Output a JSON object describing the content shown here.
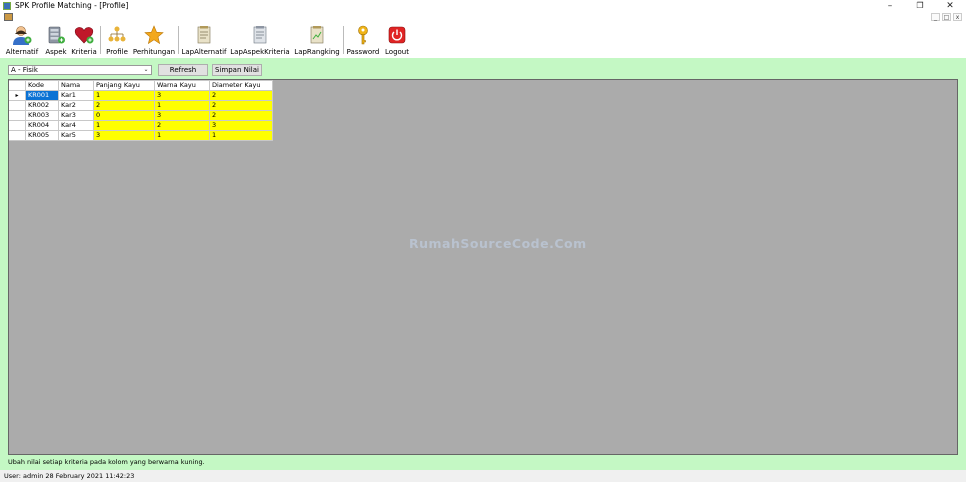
{
  "window": {
    "title": "SPK Profile Matching - [Profile]"
  },
  "toolbar": {
    "items": [
      {
        "label": "Alternatif",
        "icon": "user-icon"
      },
      {
        "label": "Aspek",
        "icon": "database-add-icon"
      },
      {
        "label": "Kriteria",
        "icon": "heart-icon"
      },
      {
        "label": "Profile",
        "icon": "hierarchy-icon"
      },
      {
        "label": "Perhitungan",
        "icon": "star-icon"
      },
      {
        "label": "LapAlternatif",
        "icon": "report-icon"
      },
      {
        "label": "LapAspekKriteria",
        "icon": "report-icon"
      },
      {
        "label": "LapRangking",
        "icon": "report-icon"
      },
      {
        "label": "Password",
        "icon": "key-icon"
      },
      {
        "label": "Logout",
        "icon": "power-icon"
      }
    ]
  },
  "filter": {
    "selected": "A - Fisik",
    "refresh_label": "Refresh",
    "save_label": "Simpan Nilai"
  },
  "grid": {
    "columns": [
      "Kode",
      "Nama",
      "Panjang Kayu",
      "Warna Kayu",
      "Diameter Kayu"
    ],
    "rows": [
      [
        "KR001",
        "Kar1",
        "1",
        "3",
        "2"
      ],
      [
        "KR002",
        "Kar2",
        "2",
        "1",
        "2"
      ],
      [
        "KR003",
        "Kar3",
        "0",
        "3",
        "2"
      ],
      [
        "KR004",
        "Kar4",
        "1",
        "2",
        "3"
      ],
      [
        "KR005",
        "Kar5",
        "3",
        "1",
        "1"
      ]
    ],
    "current_row_marker": "▸",
    "watermark": "RumahSourceCode.Com"
  },
  "hint": "Ubah nilai setiap kriteria pada kolom yang berwarna kuning.",
  "statusbar": {
    "text": "User: admin  28 February 2021 11:42:23"
  },
  "colors": {
    "panel": "#c4f8c4",
    "editable_cell": "#ffff00",
    "selection": "#0b72d4",
    "grid_bg": "#ababab"
  }
}
